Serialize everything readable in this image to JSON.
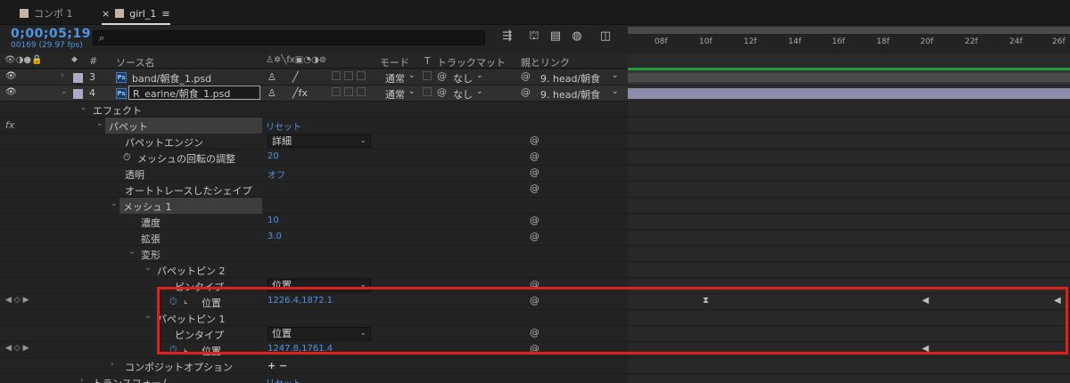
{
  "tabs": [
    {
      "label": "コンポ 1",
      "close": ""
    },
    {
      "label": "girl_1",
      "close": "×",
      "menu": "≡"
    }
  ],
  "timecode": {
    "value": "0;00;05;19",
    "sub": "00169 (29.97 fps)"
  },
  "search": {
    "placeholder": ""
  },
  "ruler_ticks": [
    "08f",
    "10f",
    "12f",
    "14f",
    "16f",
    "18f",
    "20f",
    "22f",
    "24f",
    "26f"
  ],
  "columns": {
    "hash": "#",
    "source": "ソース名",
    "mode": "モード",
    "t": "T",
    "track": "トラックマット",
    "parent": "親とリンク"
  },
  "layers": [
    {
      "num": "3",
      "name": "band/朝食_1.psd",
      "mode": "通常",
      "track": "なし",
      "parent": "9. head/朝食"
    },
    {
      "num": "4",
      "name": "R_earine/朝食_1.psd",
      "mode": "通常",
      "track": "なし",
      "parent": "9. head/朝食"
    }
  ],
  "tree": {
    "effects": "エフェクト",
    "puppet": "パペット",
    "reset": "リセット",
    "engine_label": "パペットエンジン",
    "engine_value": "詳細",
    "mesh_rot_label": "メッシュの回転の調整",
    "mesh_rot_value": "20",
    "opacity_label": "透明",
    "opacity_value": "オフ",
    "autotrace": "オートトレースしたシェイプ",
    "mesh1": "メッシュ 1",
    "density_label": "濃度",
    "density_value": "10",
    "expand_label": "拡張",
    "expand_value": "3.0",
    "deform": "変形",
    "pin2": "パペットピン 2",
    "pintype_label": "ピンタイプ",
    "pintype_value": "位置",
    "position_label": "位置",
    "pin2_pos": "1226.4,1872.1",
    "pin1": "パペットピン 1",
    "pin1_pos": "1247.8,1761.4",
    "composite": "コンポジットオプション",
    "composite_value": "+ −",
    "transform": "トランスフォーム",
    "transform_reset": "リセット"
  },
  "colors": {
    "accent": "#4f95e6",
    "highlight": "#e0201b",
    "bar": "#8e8fb0"
  }
}
